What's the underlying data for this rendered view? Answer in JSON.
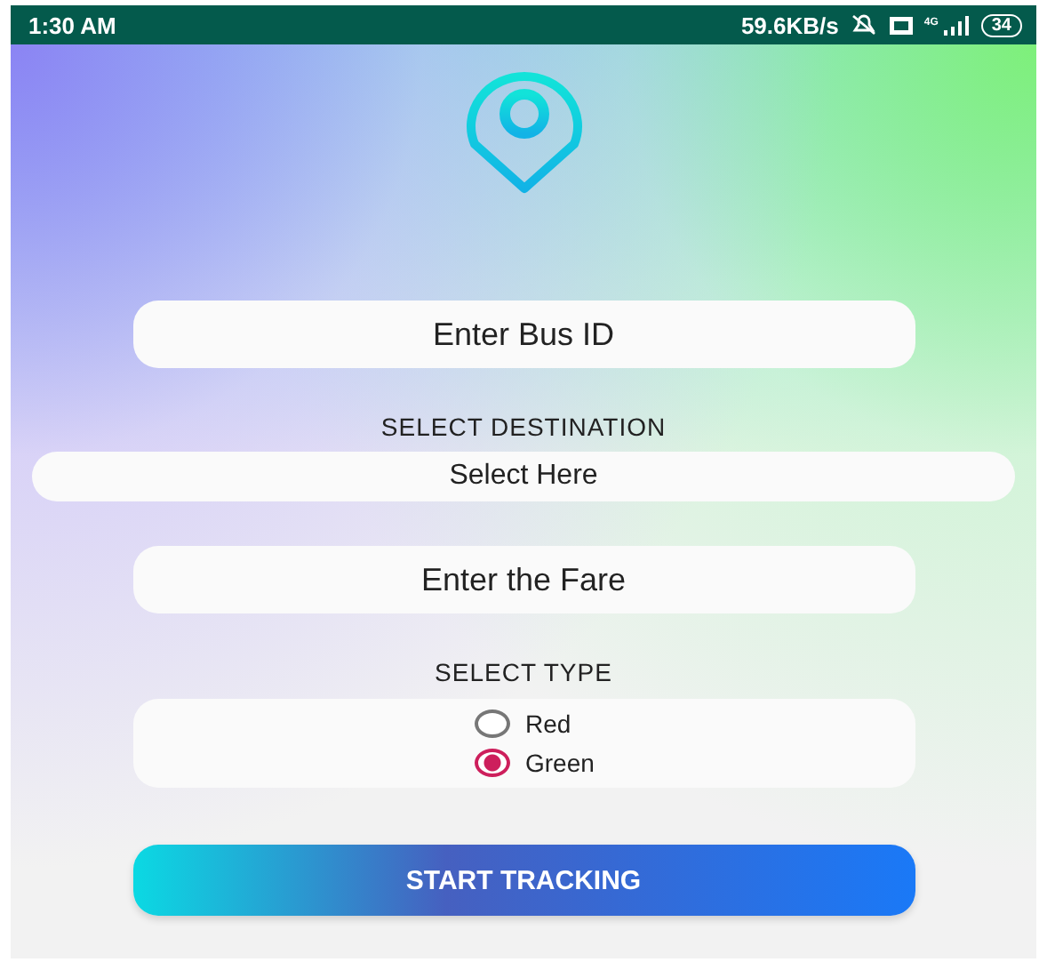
{
  "status_bar": {
    "time": "1:30 AM",
    "speed": "59.6KB/s",
    "network": "4G",
    "battery": "34"
  },
  "bus_id": {
    "placeholder": "Enter Bus ID"
  },
  "destination": {
    "label": "SELECT DESTINATION",
    "value": "Select Here"
  },
  "fare": {
    "placeholder": "Enter the Fare"
  },
  "type": {
    "label": "SELECT TYPE",
    "options": [
      {
        "label": "Red",
        "selected": false
      },
      {
        "label": "Green",
        "selected": true
      }
    ]
  },
  "button": "START TRACKING"
}
